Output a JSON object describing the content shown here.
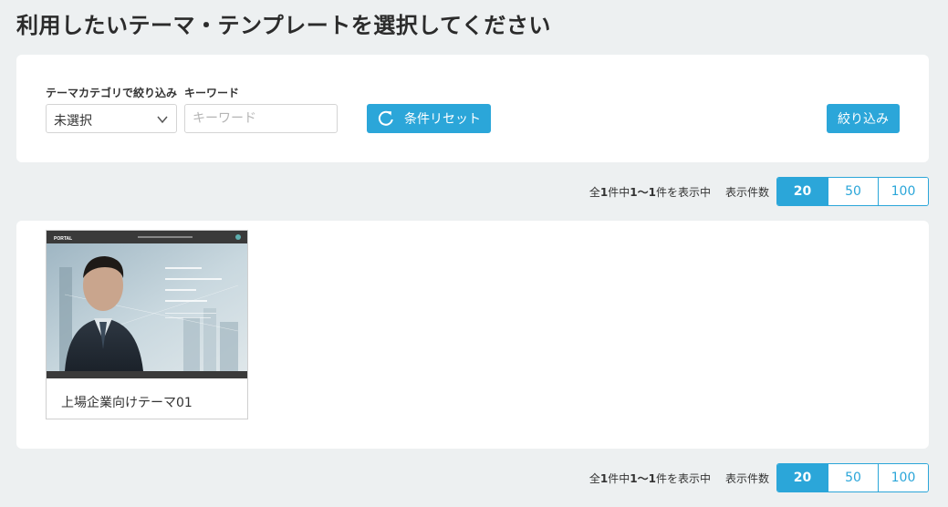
{
  "page": {
    "title": "利用したいテーマ・テンプレートを選択してください"
  },
  "filters": {
    "category_label": "テーマカテゴリで絞り込み",
    "category_value": "未選択",
    "keyword_label": "キーワード",
    "keyword_placeholder": "キーワード",
    "keyword_value": "",
    "reset_label": "条件リセット",
    "filter_label": "絞り込み"
  },
  "pagination": {
    "count_prefix": "全",
    "total": "1",
    "count_mid": "件中",
    "range": "1〜1",
    "count_suffix": "件を表示中",
    "per_page_label": "表示件数",
    "sizes": [
      "20",
      "50",
      "100"
    ],
    "active_size": "20"
  },
  "results": [
    {
      "name": "上場企業向けテーマ01",
      "thumbnail": {
        "brand": "PORTAL",
        "copy_lines": [
          "明日の",
          "価値を育む企業として",
          "人の力",
          "未来を創る"
        ]
      }
    }
  ],
  "colors": {
    "accent": "#2ba6d9",
    "background": "#edf0f1"
  },
  "icons": {
    "select": "chevron-down-icon",
    "reset": "refresh-icon"
  }
}
